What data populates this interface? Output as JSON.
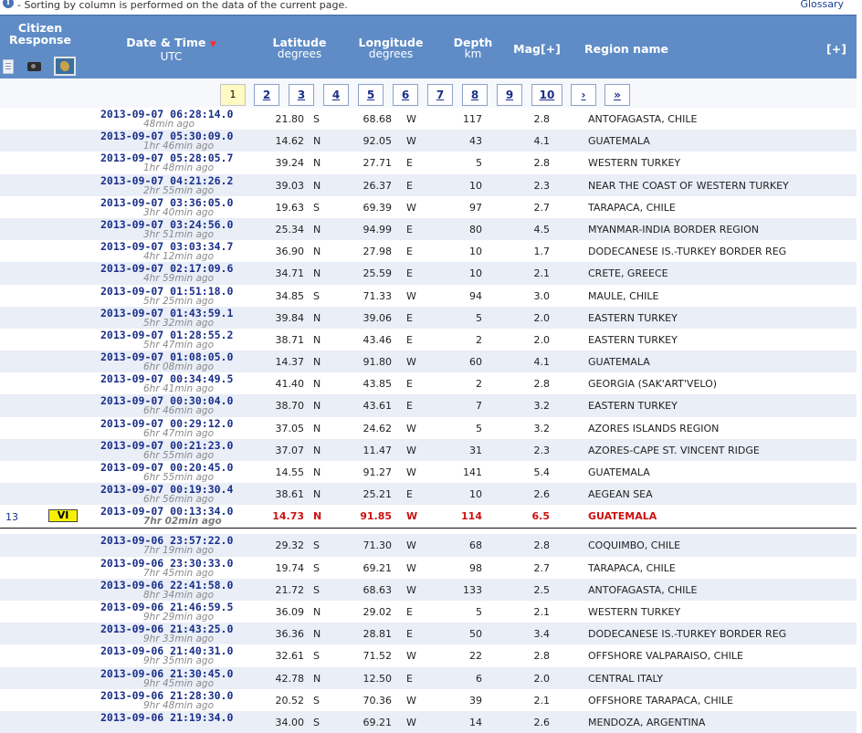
{
  "top": {
    "note": "- Sorting by column is performed on the data of the current page.",
    "glossary": "Glossary",
    "info_icon": "info-icon"
  },
  "header": {
    "citizen": "Citizen Response",
    "date": "Date & Time",
    "date_sub": "UTC",
    "lat": "Latitude",
    "lat_sub": "degrees",
    "lon": "Longitude",
    "lon_sub": "degrees",
    "depth": "Depth",
    "depth_sub": "km",
    "mag": "Mag[+]",
    "region": "Region name",
    "plus": "[+]",
    "sort_indicator": "▼"
  },
  "pager": {
    "pages": [
      "1",
      "2",
      "3",
      "4",
      "5",
      "6",
      "7",
      "8",
      "9",
      "10",
      "›",
      "»"
    ],
    "current": "1"
  },
  "rows_before": [
    {
      "date": "2013-09-07  06:28:14.0",
      "ago": "48min ago",
      "lat": "21.80",
      "ns": "S",
      "lon": "68.68",
      "ew": "W",
      "depth": "117",
      "mag": "2.8",
      "region": "ANTOFAGASTA, CHILE"
    },
    {
      "date": "2013-09-07  05:30:09.0",
      "ago": "1hr 46min ago",
      "lat": "14.62",
      "ns": "N",
      "lon": "92.05",
      "ew": "W",
      "depth": "43",
      "mag": "4.1",
      "region": "GUATEMALA"
    },
    {
      "date": "2013-09-07  05:28:05.7",
      "ago": "1hr 48min ago",
      "lat": "39.24",
      "ns": "N",
      "lon": "27.71",
      "ew": "E",
      "depth": "5",
      "mag": "2.8",
      "region": "WESTERN TURKEY"
    },
    {
      "date": "2013-09-07  04:21:26.2",
      "ago": "2hr 55min ago",
      "lat": "39.03",
      "ns": "N",
      "lon": "26.37",
      "ew": "E",
      "depth": "10",
      "mag": "2.3",
      "region": "NEAR THE COAST OF WESTERN TURKEY"
    },
    {
      "date": "2013-09-07  03:36:05.0",
      "ago": "3hr 40min ago",
      "lat": "19.63",
      "ns": "S",
      "lon": "69.39",
      "ew": "W",
      "depth": "97",
      "mag": "2.7",
      "region": "TARAPACA, CHILE"
    },
    {
      "date": "2013-09-07  03:24:56.0",
      "ago": "3hr 51min ago",
      "lat": "25.34",
      "ns": "N",
      "lon": "94.99",
      "ew": "E",
      "depth": "80",
      "mag": "4.5",
      "region": "MYANMAR-INDIA BORDER REGION"
    },
    {
      "date": "2013-09-07  03:03:34.7",
      "ago": "4hr 12min ago",
      "lat": "36.90",
      "ns": "N",
      "lon": "27.98",
      "ew": "E",
      "depth": "10",
      "mag": "1.7",
      "region": "DODECANESE IS.-TURKEY BORDER REG"
    },
    {
      "date": "2013-09-07  02:17:09.6",
      "ago": "4hr 59min ago",
      "lat": "34.71",
      "ns": "N",
      "lon": "25.59",
      "ew": "E",
      "depth": "10",
      "mag": "2.1",
      "region": "CRETE, GREECE"
    },
    {
      "date": "2013-09-07  01:51:18.0",
      "ago": "5hr 25min ago",
      "lat": "34.85",
      "ns": "S",
      "lon": "71.33",
      "ew": "W",
      "depth": "94",
      "mag": "3.0",
      "region": "MAULE, CHILE"
    },
    {
      "date": "2013-09-07  01:43:59.1",
      "ago": "5hr 32min ago",
      "lat": "39.84",
      "ns": "N",
      "lon": "39.06",
      "ew": "E",
      "depth": "5",
      "mag": "2.0",
      "region": "EASTERN TURKEY"
    },
    {
      "date": "2013-09-07  01:28:55.2",
      "ago": "5hr 47min ago",
      "lat": "38.71",
      "ns": "N",
      "lon": "43.46",
      "ew": "E",
      "depth": "2",
      "mag": "2.0",
      "region": "EASTERN TURKEY"
    },
    {
      "date": "2013-09-07  01:08:05.0",
      "ago": "6hr 08min ago",
      "lat": "14.37",
      "ns": "N",
      "lon": "91.80",
      "ew": "W",
      "depth": "60",
      "mag": "4.1",
      "region": "GUATEMALA"
    },
    {
      "date": "2013-09-07  00:34:49.5",
      "ago": "6hr 41min ago",
      "lat": "41.40",
      "ns": "N",
      "lon": "43.85",
      "ew": "E",
      "depth": "2",
      "mag": "2.8",
      "region": "GEORGIA (SAK'ART'VELO)"
    },
    {
      "date": "2013-09-07  00:30:04.0",
      "ago": "6hr 46min ago",
      "lat": "38.70",
      "ns": "N",
      "lon": "43.61",
      "ew": "E",
      "depth": "7",
      "mag": "3.2",
      "region": "EASTERN TURKEY"
    },
    {
      "date": "2013-09-07  00:29:12.0",
      "ago": "6hr 47min ago",
      "lat": "37.05",
      "ns": "N",
      "lon": "24.62",
      "ew": "W",
      "depth": "5",
      "mag": "3.2",
      "region": "AZORES ISLANDS REGION"
    },
    {
      "date": "2013-09-07  00:21:23.0",
      "ago": "6hr 55min ago",
      "lat": "37.07",
      "ns": "N",
      "lon": "11.47",
      "ew": "W",
      "depth": "31",
      "mag": "2.3",
      "region": "AZORES-CAPE ST. VINCENT RIDGE"
    },
    {
      "date": "2013-09-07  00:20:45.0",
      "ago": "6hr 55min ago",
      "lat": "14.55",
      "ns": "N",
      "lon": "91.27",
      "ew": "W",
      "depth": "141",
      "mag": "5.4",
      "region": "GUATEMALA"
    },
    {
      "date": "2013-09-07  00:19:30.4",
      "ago": "6hr 56min ago",
      "lat": "38.61",
      "ns": "N",
      "lon": "25.21",
      "ew": "E",
      "depth": "10",
      "mag": "2.6",
      "region": "AEGEAN SEA"
    }
  ],
  "highlight": {
    "num": "13",
    "intensity": "VI",
    "date": "2013-09-07  00:13:34.0",
    "ago": "7hr 02min ago",
    "lat": "14.73",
    "ns": "N",
    "lon": "91.85",
    "ew": "W",
    "depth": "114",
    "mag": "6.5",
    "region": "GUATEMALA"
  },
  "rows_after": [
    {
      "date": "2013-09-06  23:57:22.0",
      "ago": "7hr 19min ago",
      "lat": "29.32",
      "ns": "S",
      "lon": "71.30",
      "ew": "W",
      "depth": "68",
      "mag": "2.8",
      "region": "COQUIMBO, CHILE"
    },
    {
      "date": "2013-09-06  23:30:33.0",
      "ago": "7hr 45min ago",
      "lat": "19.74",
      "ns": "S",
      "lon": "69.21",
      "ew": "W",
      "depth": "98",
      "mag": "2.7",
      "region": "TARAPACA, CHILE"
    },
    {
      "date": "2013-09-06  22:41:58.0",
      "ago": "8hr 34min ago",
      "lat": "21.72",
      "ns": "S",
      "lon": "68.63",
      "ew": "W",
      "depth": "133",
      "mag": "2.5",
      "region": "ANTOFAGASTA, CHILE"
    },
    {
      "date": "2013-09-06  21:46:59.5",
      "ago": "9hr 29min ago",
      "lat": "36.09",
      "ns": "N",
      "lon": "29.02",
      "ew": "E",
      "depth": "5",
      "mag": "2.1",
      "region": "WESTERN TURKEY"
    },
    {
      "date": "2013-09-06  21:43:25.0",
      "ago": "9hr 33min ago",
      "lat": "36.36",
      "ns": "N",
      "lon": "28.81",
      "ew": "E",
      "depth": "50",
      "mag": "3.4",
      "region": "DODECANESE IS.-TURKEY BORDER REG"
    },
    {
      "date": "2013-09-06  21:40:31.0",
      "ago": "9hr 35min ago",
      "lat": "32.61",
      "ns": "S",
      "lon": "71.52",
      "ew": "W",
      "depth": "22",
      "mag": "2.8",
      "region": "OFFSHORE VALPARAISO, CHILE"
    },
    {
      "date": "2013-09-06  21:30:45.0",
      "ago": "9hr 45min ago",
      "lat": "42.78",
      "ns": "N",
      "lon": "12.50",
      "ew": "E",
      "depth": "6",
      "mag": "2.0",
      "region": "CENTRAL ITALY"
    },
    {
      "date": "2013-09-06  21:28:30.0",
      "ago": "9hr 48min ago",
      "lat": "20.52",
      "ns": "S",
      "lon": "70.36",
      "ew": "W",
      "depth": "39",
      "mag": "2.1",
      "region": "OFFSHORE TARAPACA, CHILE"
    },
    {
      "date": "2013-09-06  21:19:34.0",
      "ago": "",
      "lat": "34.00",
      "ns": "S",
      "lon": "69.21",
      "ew": "W",
      "depth": "14",
      "mag": "2.6",
      "region": "MENDOZA, ARGENTINA"
    }
  ]
}
